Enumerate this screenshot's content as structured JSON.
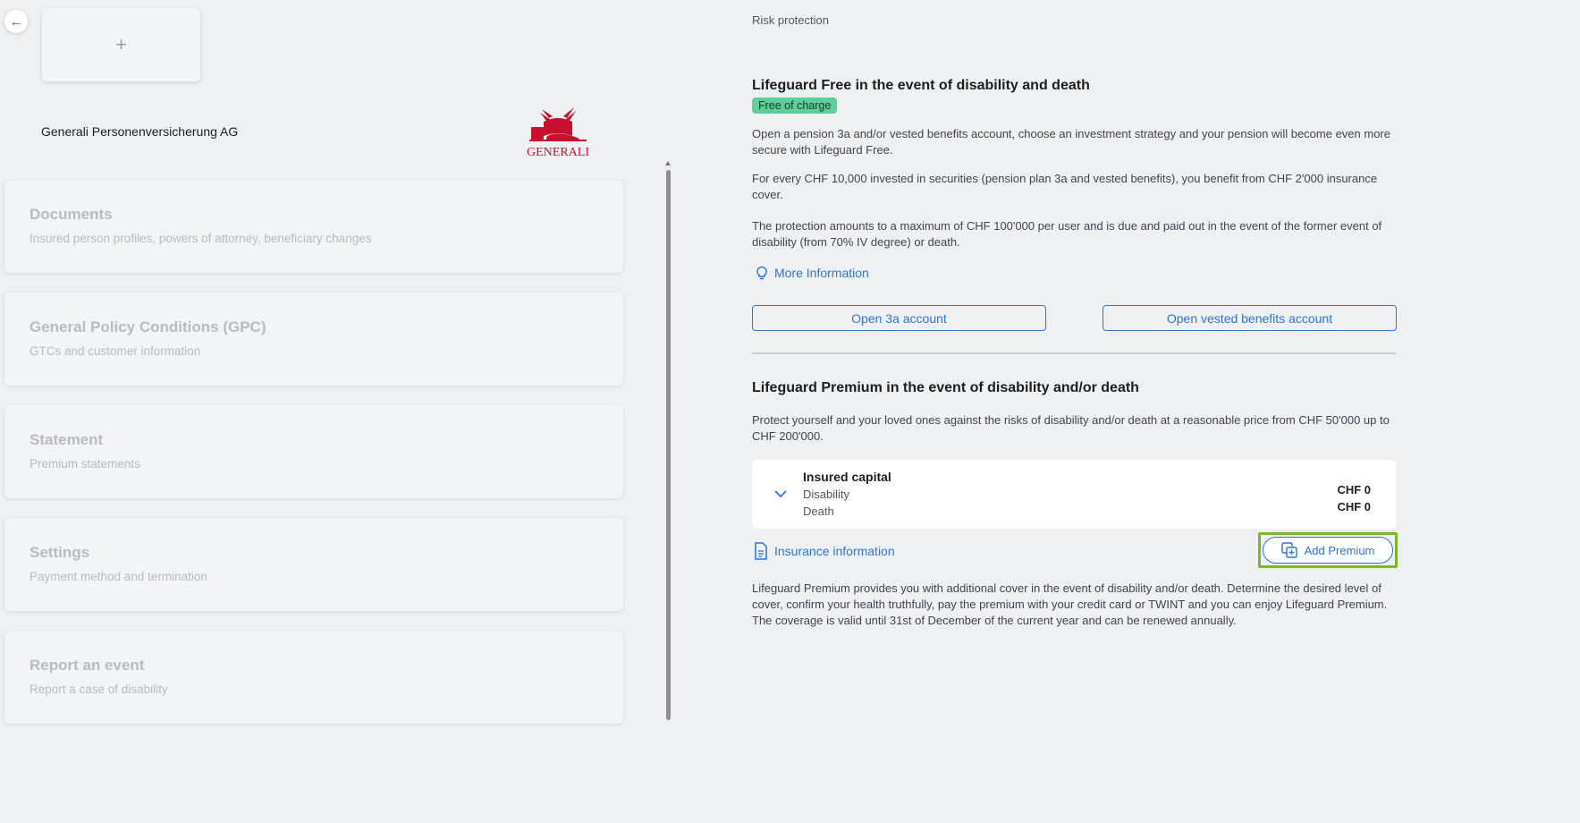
{
  "company": {
    "name": "Generali Personenversicherung AG",
    "logo_text": "GENERALI",
    "brand_color": "#c8102e"
  },
  "add_card": {
    "icon": "plus-icon",
    "glyph": "+"
  },
  "back": {
    "icon": "arrow-left-icon",
    "glyph": "←"
  },
  "menu": [
    {
      "title": "Documents",
      "subtitle": "Insured person profiles, powers of attorney, beneficiary changes"
    },
    {
      "title": "General Policy Conditions (GPC)",
      "subtitle": "GTCs and customer information"
    },
    {
      "title": "Statement",
      "subtitle": "Premium statements"
    },
    {
      "title": "Settings",
      "subtitle": "Payment method and termination"
    },
    {
      "title": "Report an event",
      "subtitle": "Report a case of disability"
    }
  ],
  "right": {
    "section_label": "Risk protection",
    "free": {
      "title": "Lifeguard Free in the event of disability and death",
      "badge": "Free of charge",
      "p1": "Open a pension 3a and/or vested benefits account, choose an investment strategy and your pension will become even more secure with Lifeguard Free.",
      "p2": "For every CHF 10,000 invested in securities (pension plan 3a and vested benefits), you benefit from CHF 2'000 insurance cover.",
      "p3": "The protection amounts to a maximum of CHF 100'000 per user and is due and paid out in the event of the former event of disability (from 70% IV degree) or death.",
      "more_info": "More Information",
      "btn_3a": "Open 3a account",
      "btn_vested": "Open vested benefits account"
    },
    "premium": {
      "title": "Lifeguard Premium in the event of disability and/or death",
      "p1": "Protect yourself and your loved ones against the risks of disability and/or death at a reasonable price from CHF 50'000 up to CHF 200'000.",
      "capital_title": "Insured capital",
      "disability_label": "Disability",
      "death_label": "Death",
      "disability_value": "CHF  0",
      "death_value": "CHF  0",
      "insurance_info": "Insurance information",
      "add_premium": "Add Premium",
      "p2": "Lifeguard Premium provides you with additional cover in the event of disability and/or death. Determine the desired level of cover, confirm your health truthfully, pay the premium with your credit card or TWINT and you can enjoy Lifeguard Premium. The coverage is valid until 31st of December of the current year and can be renewed annually."
    }
  }
}
